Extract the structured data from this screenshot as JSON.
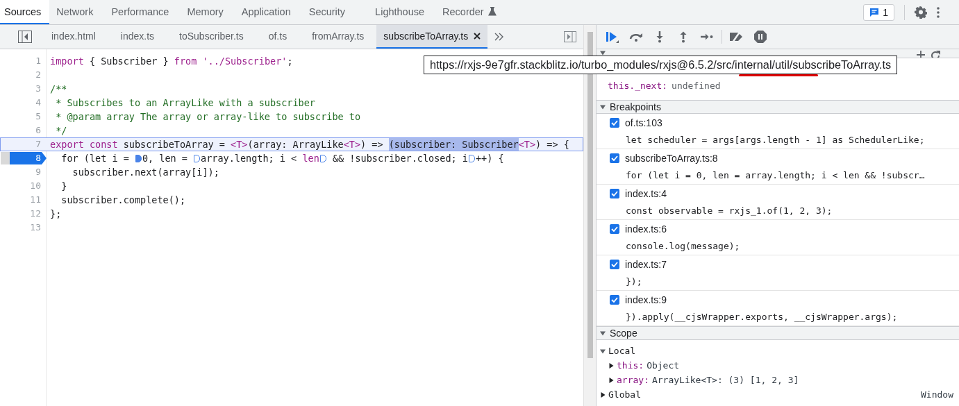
{
  "top_tabs": [
    {
      "label": "Sources",
      "selected": true,
      "kind": "plain"
    },
    {
      "label": "Network",
      "selected": false,
      "kind": "plain"
    },
    {
      "label": "Performance",
      "selected": false,
      "kind": "plain"
    },
    {
      "label": "Memory",
      "selected": false,
      "kind": "plain"
    },
    {
      "label": "Application",
      "selected": false,
      "kind": "plain"
    },
    {
      "label": "Security",
      "selected": false,
      "kind": "plain"
    },
    {
      "label": "Lighthouse",
      "selected": false,
      "kind": "plain"
    },
    {
      "label": "Recorder",
      "selected": false,
      "kind": "experimental"
    }
  ],
  "issues_badge": {
    "count": "1"
  },
  "file_tabs": [
    {
      "label": "index.html",
      "selected": false
    },
    {
      "label": "index.ts",
      "selected": false
    },
    {
      "label": "toSubscriber.ts",
      "selected": false
    },
    {
      "label": "of.ts",
      "selected": false
    },
    {
      "label": "fromArray.ts",
      "selected": false
    },
    {
      "label": "subscribeToArray.ts",
      "selected": true
    }
  ],
  "code": {
    "lines": [
      {
        "number": "1",
        "paused": false,
        "highlighted": false,
        "tokens": [
          {
            "text": "import",
            "kind": "kw"
          },
          {
            "text": " { Subscriber } ",
            "kind": "plain"
          },
          {
            "text": "from",
            "kind": "kw"
          },
          {
            "text": " '../Subscriber'",
            "kind": "str"
          },
          {
            "text": ";",
            "kind": "plain"
          }
        ]
      },
      {
        "number": "2",
        "paused": false,
        "highlighted": false
      },
      {
        "number": "3",
        "paused": false,
        "highlighted": false,
        "tokens": [
          {
            "text": "/**",
            "kind": "comment"
          }
        ]
      },
      {
        "number": "4",
        "paused": false,
        "highlighted": false,
        "tokens": [
          {
            "text": " * Subscribes to an ArrayLike with a subscriber",
            "kind": "comment"
          }
        ]
      },
      {
        "number": "5",
        "paused": false,
        "highlighted": false,
        "tokens": [
          {
            "text": " * @param array The array or array-like to subscribe to",
            "kind": "comment"
          }
        ]
      },
      {
        "number": "6",
        "paused": false,
        "highlighted": false,
        "tokens": [
          {
            "text": " */",
            "kind": "comment"
          }
        ]
      },
      {
        "number": "7",
        "paused": false,
        "highlighted": true,
        "tokens": [
          {
            "text": "export const",
            "kind": "kw"
          },
          {
            "text": " subscribeToArray = ",
            "kind": "plain"
          },
          {
            "text": "<T>",
            "kind": "type"
          },
          {
            "text": "(array: ArrayLike",
            "kind": "plain"
          },
          {
            "text": "<T>",
            "kind": "type"
          },
          {
            "text": ") => ",
            "kind": "plain"
          },
          {
            "text": "(subscriber: Subscriber",
            "kind": "sel"
          },
          {
            "text": "<T>",
            "kind": "type"
          },
          {
            "text": ") => {",
            "kind": "plain"
          }
        ]
      },
      {
        "number": "8",
        "paused": true,
        "highlighted": false,
        "tokens": [
          {
            "text": "  for (let i = ",
            "kind": "plain"
          },
          {
            "kind": "marker",
            "active": true
          },
          {
            "text": "0, len = ",
            "kind": "plain"
          },
          {
            "kind": "marker",
            "active": false
          },
          {
            "text": "array.length; i < ",
            "kind": "plain"
          },
          {
            "text": "len",
            "kind": "type"
          },
          {
            "kind": "marker",
            "active": false
          },
          {
            "text": " && !subscriber.closed; i",
            "kind": "plain"
          },
          {
            "kind": "marker",
            "active": false
          },
          {
            "text": "++) {",
            "kind": "plain"
          }
        ]
      },
      {
        "number": "9",
        "paused": false,
        "highlighted": false,
        "tokens": [
          {
            "text": "    subscriber.next(array[i]);",
            "kind": "plain"
          }
        ]
      },
      {
        "number": "10",
        "paused": false,
        "highlighted": false,
        "tokens": [
          {
            "text": "  }",
            "kind": "plain"
          }
        ]
      },
      {
        "number": "11",
        "paused": false,
        "highlighted": false,
        "tokens": [
          {
            "text": "  subscriber.complete();",
            "kind": "plain"
          }
        ]
      },
      {
        "number": "12",
        "paused": false,
        "highlighted": false,
        "tokens": [
          {
            "text": "};",
            "kind": "plain"
          }
        ]
      },
      {
        "number": "13",
        "paused": false,
        "highlighted": false
      }
    ]
  },
  "tooltip": {
    "text": "https://rxjs-9e7gfr.stackblitz.io/turbo_modules/rxjs@6.5.2/src/internal/util/subscribeToArray.ts"
  },
  "watch": {
    "expanded": true,
    "expressions": [
      {
        "name": "this._next:",
        "value": "undefined"
      }
    ]
  },
  "breakpoints": {
    "title": "Breakpoints",
    "expanded": true,
    "items": [
      {
        "location": "of.ts:103",
        "code": "let scheduler = args[args.length - 1] as SchedulerLike;",
        "checked": true
      },
      {
        "location": "subscribeToArray.ts:8",
        "code": "for (let i = 0, len = array.length; i < len && !subscr…",
        "checked": true
      },
      {
        "location": "index.ts:4",
        "code": "const observable = rxjs_1.of(1, 2, 3);",
        "checked": true
      },
      {
        "location": "index.ts:6",
        "code": "console.log(message);",
        "checked": true
      },
      {
        "location": "index.ts:7",
        "code": "});",
        "checked": true
      },
      {
        "location": "index.ts:9",
        "code": "}).apply(__cjsWrapper.exports, __cjsWrapper.args);",
        "checked": true
      }
    ]
  },
  "scope": {
    "title": "Scope",
    "expanded": true,
    "tree": [
      {
        "name": "Local",
        "expanded": true,
        "children": [
          {
            "name": "this:",
            "value": "Object",
            "expanded": false
          },
          {
            "name": "array:",
            "value": "ArrayLike<T>: (3) [1, 2, 3]",
            "expanded": false
          }
        ]
      },
      {
        "name": "Global",
        "value": "Window",
        "expanded": false
      }
    ]
  }
}
